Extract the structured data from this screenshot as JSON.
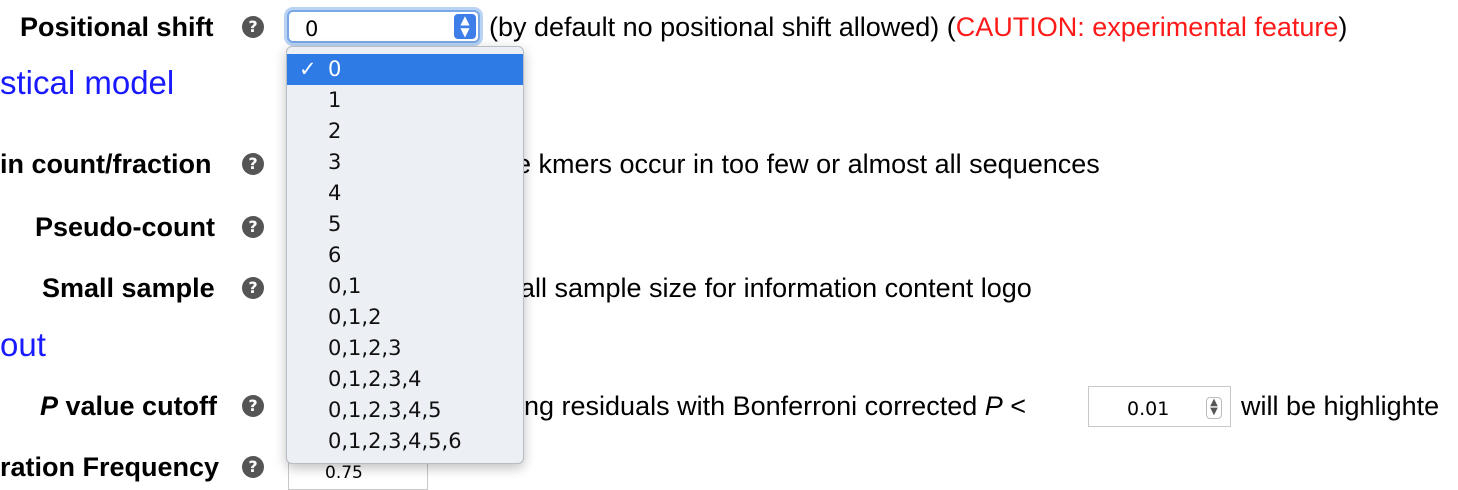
{
  "rows": {
    "positional_shift": {
      "label": "Positional shift",
      "note_open": "(by default no positional shift allowed) (",
      "caution": "CAUTION: experimental feature",
      "note_close": ")"
    },
    "section_statistical": "stical model",
    "min_count": {
      "label": "in count/fraction",
      "text_tail": "e kmers occur in too few or almost all sequences"
    },
    "pseudo_count": {
      "label": "Pseudo-count"
    },
    "small_sample": {
      "label": "Small sample",
      "text_tail": "all sample size for information content logo"
    },
    "section_output": "out",
    "p_value": {
      "label_italic": "P",
      "label_rest": " value cutoff",
      "text_tail": "ng residuals with Bonferroni corrected ",
      "p_italic": "P",
      "lt": " <",
      "input_value": "0.01",
      "text_after": "will be highlighte"
    },
    "iteration_frequency": {
      "label": "ration Frequency",
      "input_value": "0.75"
    }
  },
  "select": {
    "value": "0",
    "options": [
      "0",
      "1",
      "2",
      "3",
      "4",
      "5",
      "6",
      "0,1",
      "0,1,2",
      "0,1,2,3",
      "0,1,2,3,4",
      "0,1,2,3,4,5",
      "0,1,2,3,4,5,6"
    ],
    "selected_index": 0,
    "check_mark": "✓"
  },
  "icons": {
    "help": "?"
  }
}
